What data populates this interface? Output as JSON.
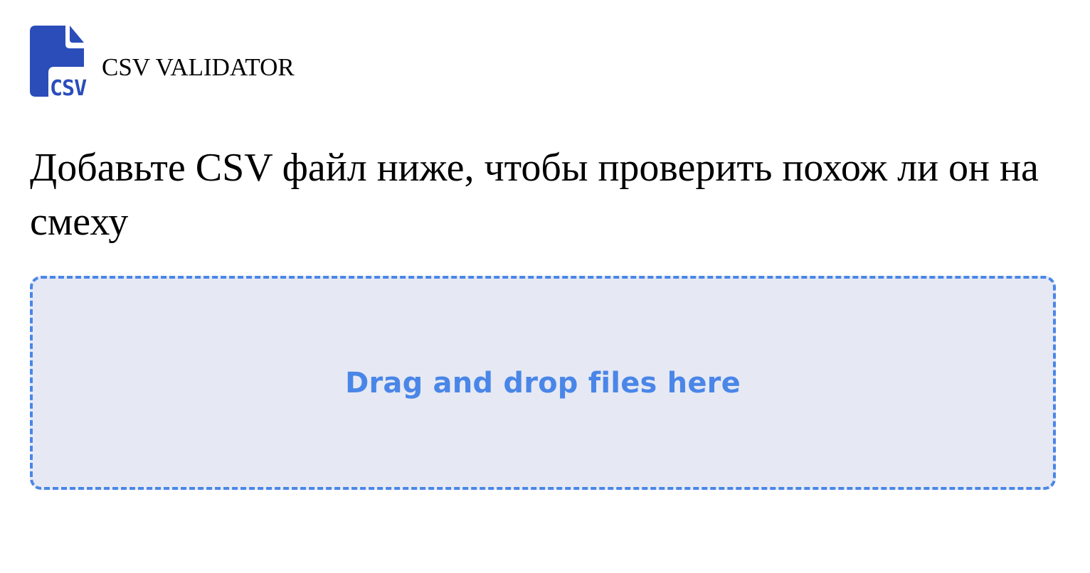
{
  "header": {
    "logo_text": "CSV",
    "logo_icon": "csv-file-icon",
    "brand_name": "CSV VALIDATOR"
  },
  "main": {
    "headline": "Добавьте CSV файл ниже, чтобы проверить похож ли он на смеху"
  },
  "dropzone": {
    "label": "Drag and drop files here"
  },
  "colors": {
    "logo": "#2b4dba",
    "accent": "#4a86e8",
    "dropzone_background": "#e6e9f3"
  }
}
